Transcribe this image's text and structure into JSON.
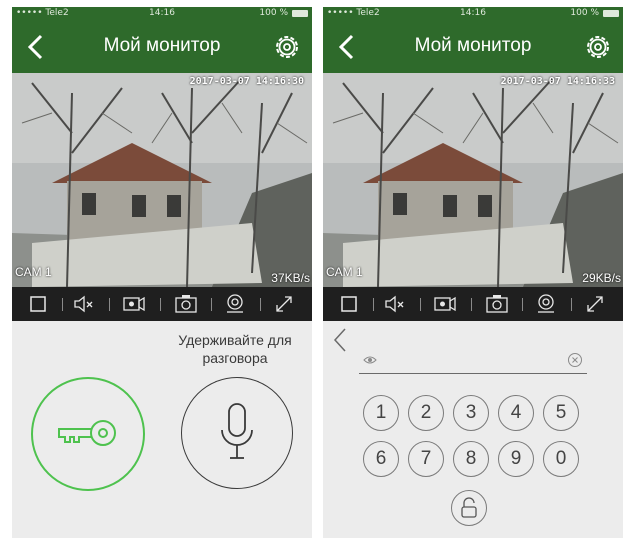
{
  "status_bar": {
    "carrier": "••••• Tele2",
    "time": "14:16"
  },
  "phones": [
    {
      "battery": "100 %",
      "timestamp": "2017-03-07 14:16:30",
      "camera_label": "CAM 1",
      "bitrate": "37KB/s"
    },
    {
      "battery": "100 %",
      "timestamp": "2017-03-07 14:16:33",
      "camera_label": "CAM 1",
      "bitrate": "29KB/s"
    }
  ],
  "header": {
    "title": "Мой монитор"
  },
  "toolbar": {
    "icons": [
      "record-square-icon",
      "mute-icon",
      "video-record-icon",
      "snapshot-icon",
      "playback-icon",
      "fullscreen-icon"
    ]
  },
  "intercom": {
    "hold_to_talk": "Удерживайте для разговора"
  },
  "keypad": {
    "placeholder": "",
    "keys": [
      "1",
      "2",
      "3",
      "4",
      "5",
      "6",
      "7",
      "8",
      "9",
      "0"
    ]
  },
  "colors": {
    "header_green": "#2e6a2b",
    "key_green": "#4ec24e",
    "toolbar_dark": "#1f1f1f",
    "panel_gray": "#ececec"
  }
}
